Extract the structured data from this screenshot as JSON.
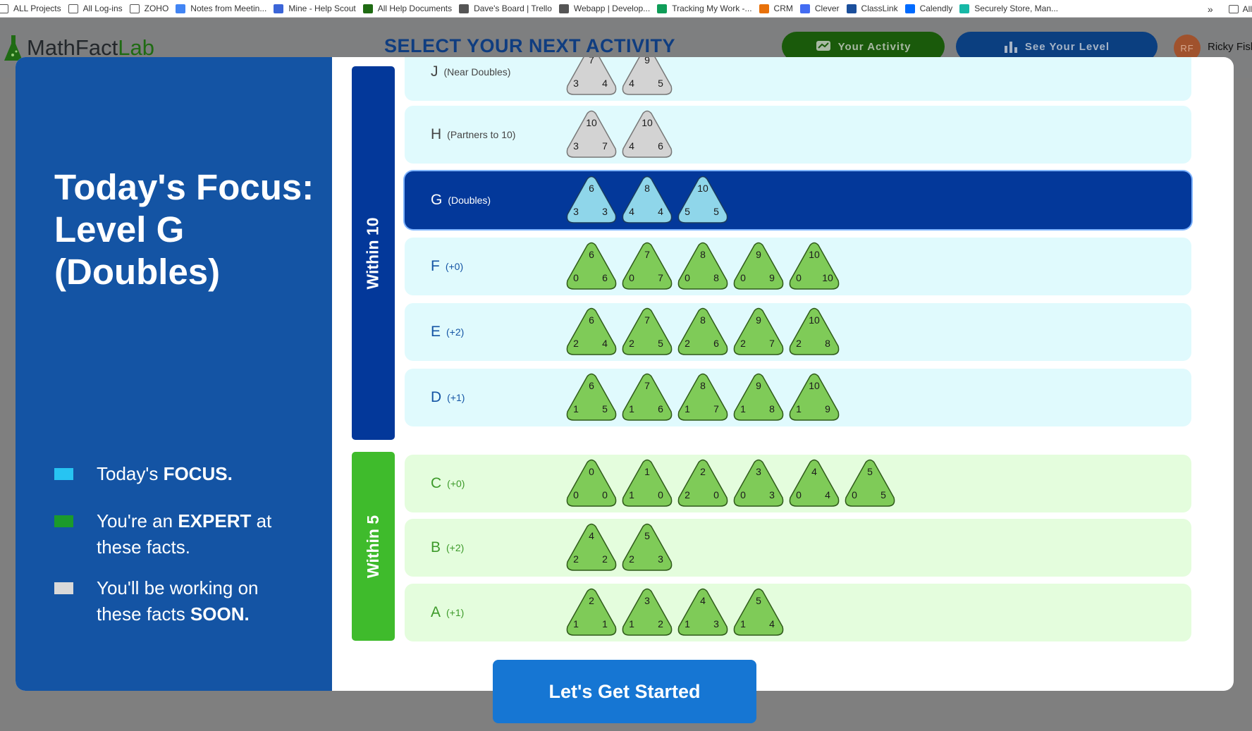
{
  "bookmarks": [
    {
      "label": "ALL Projects",
      "icon": "folder-icon"
    },
    {
      "label": "All Log-ins",
      "icon": "folder-icon"
    },
    {
      "label": "ZOHO",
      "icon": "folder-icon"
    },
    {
      "label": "Notes from Meetin...",
      "icon": "docs-icon"
    },
    {
      "label": "Mine - Help Scout",
      "icon": "helpscout-icon"
    },
    {
      "label": "All Help Documents",
      "icon": "flask-icon"
    },
    {
      "label": "Dave's Board | Trello",
      "icon": "trello-icon"
    },
    {
      "label": "Webapp | Develop...",
      "icon": "webapp-icon"
    },
    {
      "label": "Tracking My Work -...",
      "icon": "sheets-icon"
    },
    {
      "label": "CRM",
      "icon": "crm-icon"
    },
    {
      "label": "Clever",
      "icon": "clever-icon"
    },
    {
      "label": "ClassLink",
      "icon": "classlink-icon"
    },
    {
      "label": "Calendly",
      "icon": "calendly-icon"
    },
    {
      "label": "Securely Store, Man...",
      "icon": "store-icon"
    }
  ],
  "bookmarks_more": "»",
  "bookmarks_other": "All",
  "app": {
    "logo_math": "MathFact",
    "logo_lab": "Lab",
    "title": "SELECT YOUR NEXT ACTIVITY",
    "activity_btn": "Your Activity",
    "level_btn": "See Your Level",
    "avatar": "RF",
    "user": "Ricky Fisl"
  },
  "panel": {
    "focus_line1": "Today's Focus:",
    "focus_line2": "Level G",
    "focus_line3": "(Doubles)",
    "legend": [
      {
        "pre": "Today's ",
        "bold": "FOCUS.",
        "post": "",
        "color": "#27c4f2"
      },
      {
        "pre": "You're an ",
        "bold": "EXPERT",
        "post": " at these facts.",
        "color": "#1b9a2c"
      },
      {
        "pre": "You'll be working on these facts ",
        "bold": "SOON.",
        "post": "",
        "color": "#d9d9d9"
      }
    ]
  },
  "bands": {
    "within10": "Within 10",
    "within5": "Within 5"
  },
  "levels": [
    {
      "letter": "J",
      "desc": "(Near Doubles)",
      "state": "soon",
      "facts": [
        [
          7,
          3,
          4
        ],
        [
          9,
          4,
          5
        ]
      ]
    },
    {
      "letter": "H",
      "desc": "(Partners to 10)",
      "state": "soon",
      "facts": [
        [
          10,
          3,
          7
        ],
        [
          10,
          4,
          6
        ]
      ]
    },
    {
      "letter": "G",
      "desc": "(Doubles)",
      "state": "focus",
      "facts": [
        [
          6,
          3,
          3
        ],
        [
          8,
          4,
          4
        ],
        [
          10,
          5,
          5
        ]
      ]
    },
    {
      "letter": "F",
      "desc": "(+0)",
      "state": "expert10",
      "facts": [
        [
          6,
          0,
          6
        ],
        [
          7,
          0,
          7
        ],
        [
          8,
          0,
          8
        ],
        [
          9,
          0,
          9
        ],
        [
          10,
          0,
          10
        ]
      ]
    },
    {
      "letter": "E",
      "desc": "(+2)",
      "state": "expert10",
      "facts": [
        [
          6,
          2,
          4
        ],
        [
          7,
          2,
          5
        ],
        [
          8,
          2,
          6
        ],
        [
          9,
          2,
          7
        ],
        [
          10,
          2,
          8
        ]
      ]
    },
    {
      "letter": "D",
      "desc": "(+1)",
      "state": "expert10",
      "facts": [
        [
          6,
          1,
          5
        ],
        [
          7,
          1,
          6
        ],
        [
          8,
          1,
          7
        ],
        [
          9,
          1,
          8
        ],
        [
          10,
          1,
          9
        ]
      ]
    },
    {
      "letter": "C",
      "desc": "(+0)",
      "state": "expert5",
      "facts": [
        [
          0,
          0,
          0
        ],
        [
          1,
          1,
          0
        ],
        [
          2,
          2,
          0
        ],
        [
          3,
          0,
          3
        ],
        [
          4,
          0,
          4
        ],
        [
          5,
          0,
          5
        ]
      ]
    },
    {
      "letter": "B",
      "desc": "(+2)",
      "state": "expert5",
      "facts": [
        [
          4,
          2,
          2
        ],
        [
          5,
          2,
          3
        ]
      ]
    },
    {
      "letter": "A",
      "desc": "(+1)",
      "state": "expert5",
      "facts": [
        [
          2,
          1,
          1
        ],
        [
          3,
          1,
          2
        ],
        [
          4,
          1,
          3
        ],
        [
          5,
          1,
          4
        ]
      ]
    }
  ],
  "cta": "Let's Get Started",
  "colors": {
    "focus_row": "#03389a",
    "within10_row": "#e0fafd",
    "within5_row": "#e4fddd",
    "within10_band": "#03389a",
    "within5_band": "#3fbb2c",
    "tri_green": "#7fcb58",
    "tri_gray": "#d3d3d3",
    "tri_blue": "#8fd6ea"
  }
}
